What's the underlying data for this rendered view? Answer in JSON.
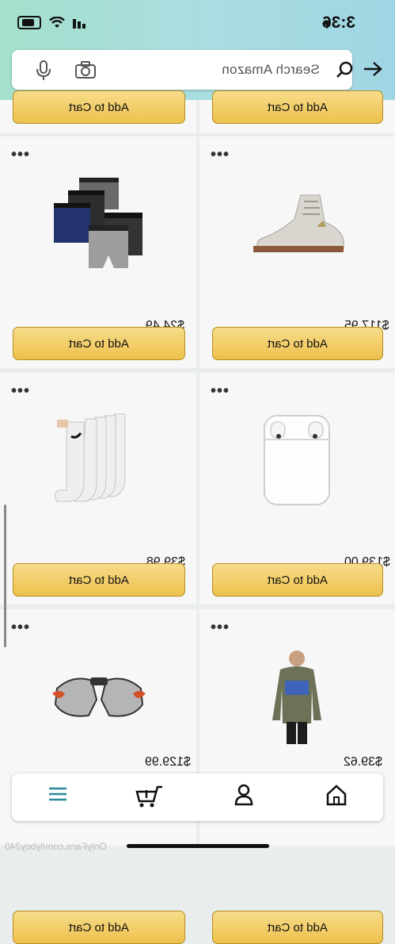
{
  "status": {
    "time": "3:36"
  },
  "search": {
    "placeholder": "Search Amazon"
  },
  "products": [
    {
      "id": "p1",
      "price": "$24.49",
      "button": "Add to Cart",
      "image": "boxer-briefs"
    },
    {
      "id": "p2",
      "price": "$117.95",
      "button": "Add to Cart",
      "image": "wrestling-shoe"
    },
    {
      "id": "p3",
      "price": "$39.98",
      "button": "Add to Cart",
      "image": "socks"
    },
    {
      "id": "p4",
      "price": "$139.00",
      "button": "Add to Cart",
      "image": "airpods"
    },
    {
      "id": "p5",
      "price": "$129.99",
      "button": "Add to Cart",
      "image": "shoulder-pads"
    },
    {
      "id": "p6",
      "price": "$39.62",
      "button": "Add to Cart",
      "image": "sweatshirt"
    }
  ],
  "top_partial_buttons": [
    "Add to Cart",
    "Add to Cart"
  ],
  "watermark": "OnlyFans.com/lyboy240",
  "colors": {
    "header_bg": "#a9dde2",
    "button_bg": "#eec14d",
    "active_tab": "#2a8a9c"
  }
}
